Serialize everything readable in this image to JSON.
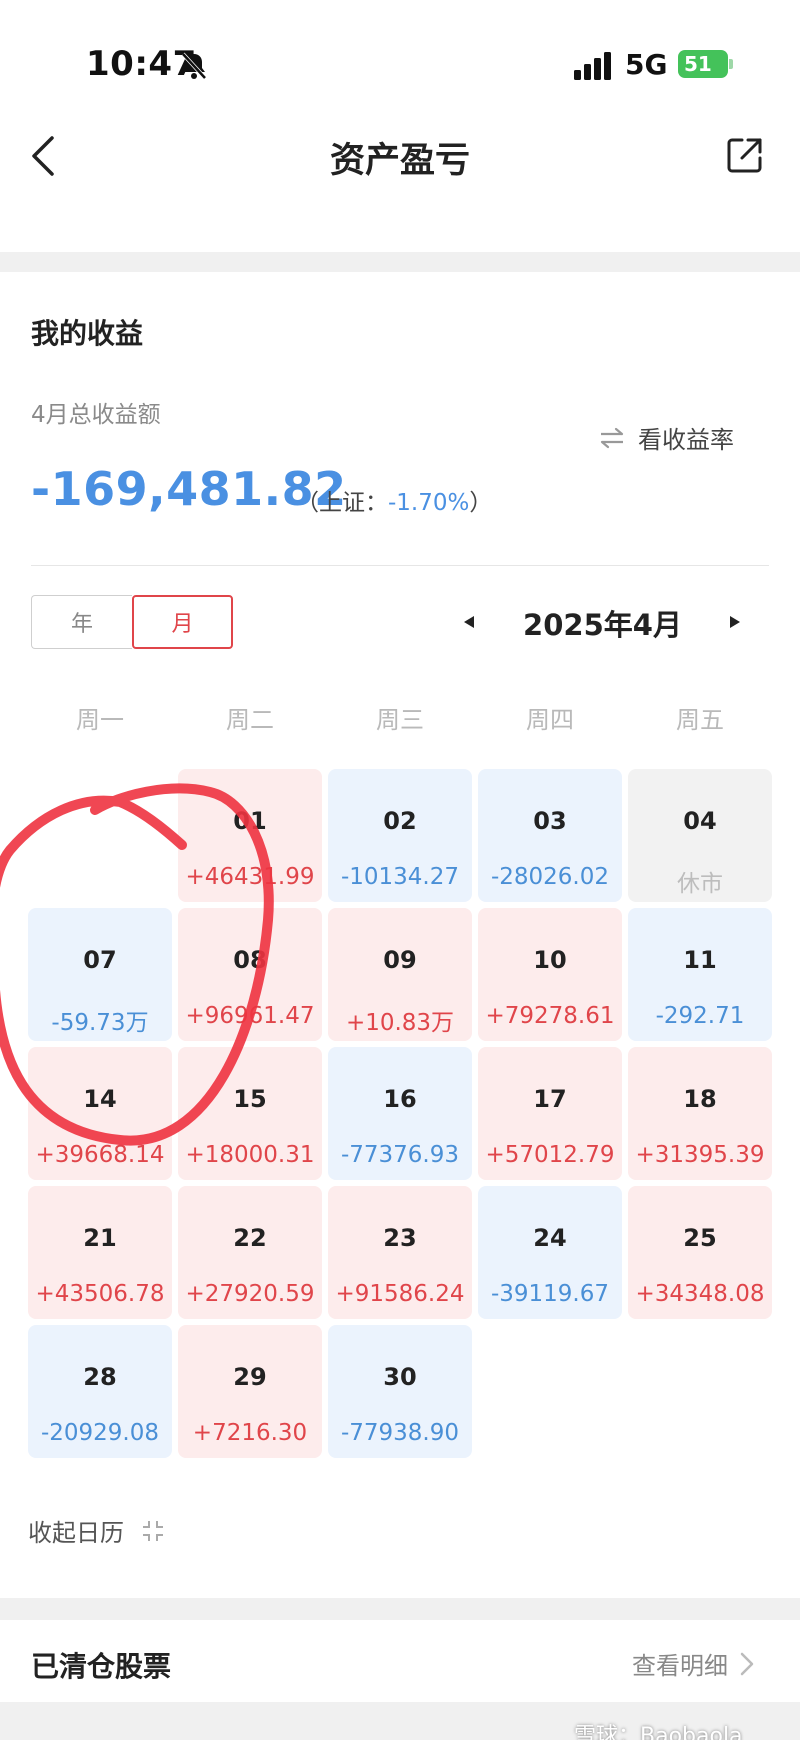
{
  "status_bar": {
    "time": "10:47",
    "network": "5G",
    "battery": "51"
  },
  "nav": {
    "title": "资产盈亏"
  },
  "earnings": {
    "section_title": "我的收益",
    "total_label": "4月总收益额",
    "toggle_label": "看收益率",
    "total_amount": "-169,481.82",
    "index_prefix": "（上证：",
    "index_value": "-1.70%",
    "index_suffix": "）"
  },
  "calendar": {
    "mode_tabs": [
      {
        "label": "年",
        "selected": false
      },
      {
        "label": "月",
        "selected": true
      }
    ],
    "month_label": "2025年4月",
    "weekdays": [
      "周一",
      "周二",
      "周三",
      "周四",
      "周五"
    ],
    "days": [
      {
        "day": "01",
        "value": "+46431.99",
        "type": "pos"
      },
      {
        "day": "02",
        "value": "-10134.27",
        "type": "neg"
      },
      {
        "day": "03",
        "value": "-28026.02",
        "type": "neg"
      },
      {
        "day": "04",
        "value": "休市",
        "type": "closed"
      },
      {
        "day": "07",
        "value": "-59.73万",
        "type": "neg"
      },
      {
        "day": "08",
        "value": "+96961.47",
        "type": "pos"
      },
      {
        "day": "09",
        "value": "+10.83万",
        "type": "pos"
      },
      {
        "day": "10",
        "value": "+79278.61",
        "type": "pos"
      },
      {
        "day": "11",
        "value": "-292.71",
        "type": "neg"
      },
      {
        "day": "14",
        "value": "+39668.14",
        "type": "pos"
      },
      {
        "day": "15",
        "value": "+18000.31",
        "type": "pos"
      },
      {
        "day": "16",
        "value": "-77376.93",
        "type": "neg"
      },
      {
        "day": "17",
        "value": "+57012.79",
        "type": "pos"
      },
      {
        "day": "18",
        "value": "+31395.39",
        "type": "pos"
      },
      {
        "day": "21",
        "value": "+43506.78",
        "type": "pos"
      },
      {
        "day": "22",
        "value": "+27920.59",
        "type": "pos"
      },
      {
        "day": "23",
        "value": "+91586.24",
        "type": "pos"
      },
      {
        "day": "24",
        "value": "-39119.67",
        "type": "neg"
      },
      {
        "day": "25",
        "value": "+34348.08",
        "type": "pos"
      },
      {
        "day": "28",
        "value": "-20929.08",
        "type": "neg"
      },
      {
        "day": "29",
        "value": "+7216.30",
        "type": "pos"
      },
      {
        "day": "30",
        "value": "-77938.90",
        "type": "neg"
      }
    ],
    "collapse_label": "收起日历"
  },
  "cleared": {
    "title": "已清仓股票",
    "detail_label": "查看明细"
  },
  "watermark": "雪球：Baobaola",
  "colors": {
    "gain": "#e0454a",
    "loss": "#4a8fd6",
    "accent": "#e0454a"
  }
}
